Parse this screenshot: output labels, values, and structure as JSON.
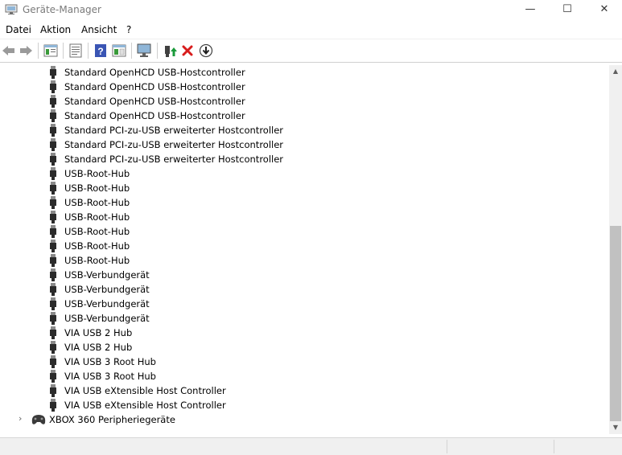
{
  "window": {
    "title": "Geräte-Manager",
    "minimize_glyph": "—",
    "maximize_glyph": "☐",
    "close_glyph": "✕"
  },
  "menu": {
    "items": [
      "Datei",
      "Aktion",
      "Ansicht",
      "?"
    ]
  },
  "toolbar": {
    "icons": [
      "back-icon",
      "forward-icon",
      "tree-view-icon",
      "properties-icon",
      "help-icon",
      "view-details-icon",
      "monitor-icon",
      "update-driver-icon",
      "uninstall-icon",
      "download-icon"
    ]
  },
  "tree": {
    "devices": [
      "Standard OpenHCD USB-Hostcontroller",
      "Standard OpenHCD USB-Hostcontroller",
      "Standard OpenHCD USB-Hostcontroller",
      "Standard OpenHCD USB-Hostcontroller",
      "Standard PCI-zu-USB erweiterter Hostcontroller",
      "Standard PCI-zu-USB erweiterter Hostcontroller",
      "Standard PCI-zu-USB erweiterter Hostcontroller",
      "USB-Root-Hub",
      "USB-Root-Hub",
      "USB-Root-Hub",
      "USB-Root-Hub",
      "USB-Root-Hub",
      "USB-Root-Hub",
      "USB-Root-Hub",
      "USB-Verbundgerät",
      "USB-Verbundgerät",
      "USB-Verbundgerät",
      "USB-Verbundgerät",
      "VIA USB 2 Hub",
      "VIA USB 2 Hub",
      "VIA USB 3 Root Hub",
      "VIA USB 3 Root Hub",
      "VIA USB eXtensible Host Controller",
      "VIA USB eXtensible Host Controller"
    ],
    "category": {
      "label": "XBOX 360 Peripheriegeräte",
      "expander_glyph": "›"
    }
  },
  "colors": {
    "accent_help": "#3a55b4",
    "uninstall_red": "#d81c1c",
    "update_green": "#1a9a3a",
    "scrollbar_thumb": "#c1c1c1"
  }
}
